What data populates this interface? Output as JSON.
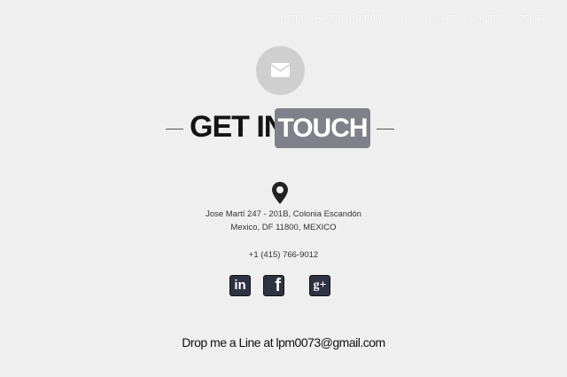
{
  "nav": {
    "items": [
      "Home",
      "About",
      "Portfolio",
      "Skills",
      "Resume",
      "Clients",
      "Process"
    ]
  },
  "header": {
    "title_part1": "GET IN",
    "title_part2": "TOUCH"
  },
  "contact": {
    "address_line1": "Jose Martí 247 - 201B, Colonia Escandón",
    "address_line2": "Mexico, DF 11800, MEXICO",
    "phone": "+1 (415) 766-9012"
  },
  "social": {
    "linkedin": "in",
    "facebook": "f",
    "googleplus": "g+"
  },
  "footer": {
    "cta": "Drop me a Line at lpm0073@gmail.com"
  },
  "colors": {
    "background": "#efefef",
    "touch_badge": "#80808a",
    "social_icon": "#2e3344"
  }
}
